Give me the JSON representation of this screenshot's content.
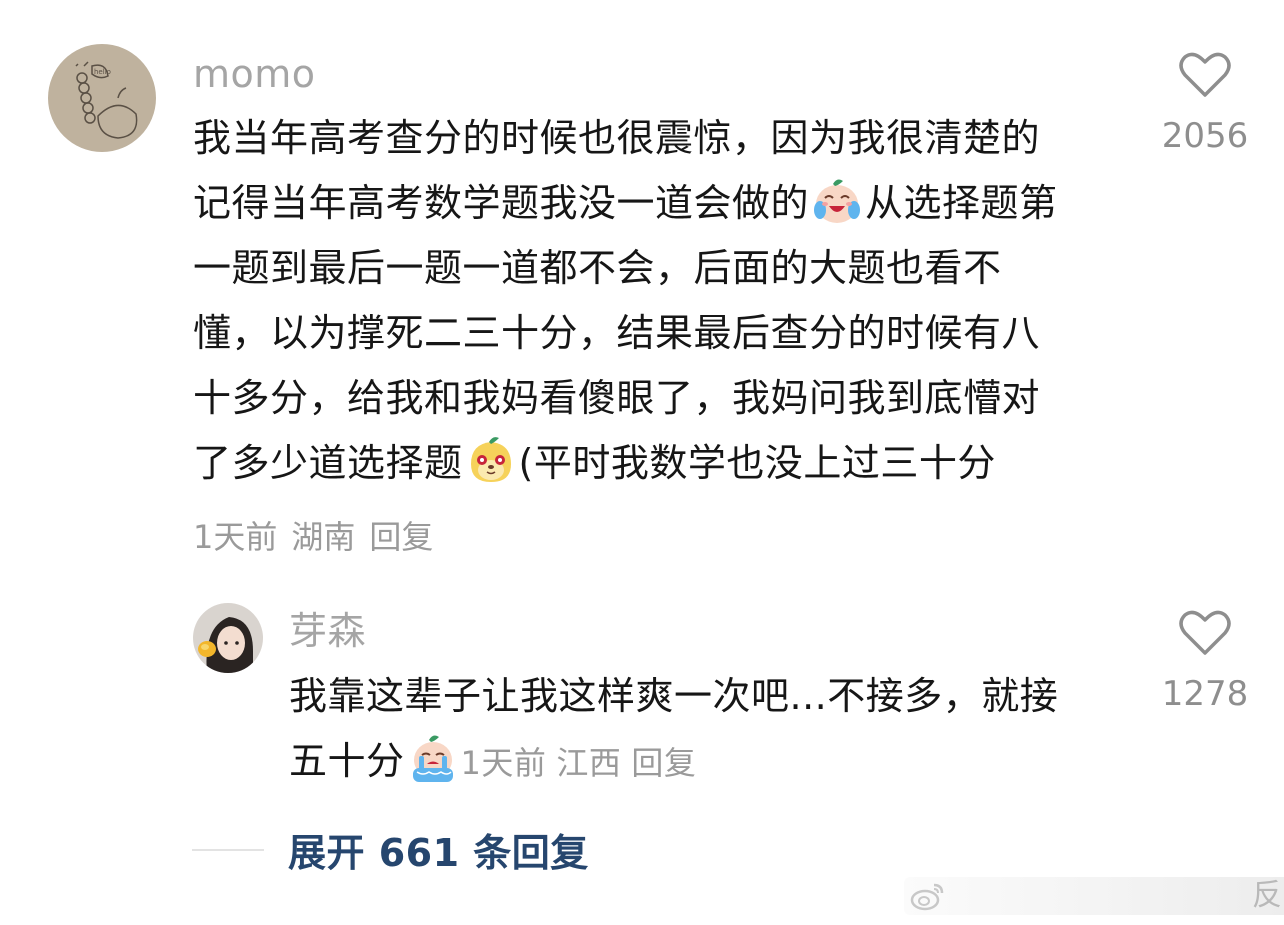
{
  "comments": [
    {
      "username": "momo",
      "avatar_text": "hello",
      "text_lines": [
        "我当年高考查分的时候也很震惊，因为我很清楚的",
        "记得当年高考数学题我没一道会做的",
        "从选择题第",
        "一题到最后一题一道都不会，后面的大题也看不",
        "懂，以为撑死二三十分，结果最后查分的时候有八",
        "十多分，给我和我妈看傻眼了，我妈问我到底懵对",
        "了多少道选择题",
        "(平时我数学也没上过三十分"
      ],
      "emojis": [
        "crying-laugh-emoji",
        "cute-face-emoji"
      ],
      "time": "1天前",
      "location": "湖南",
      "reply_label": "回复",
      "like_count": "2056"
    },
    {
      "username": "芽森",
      "text_lines": [
        "我靠这辈子让我这样爽一次吧...不接多，就接",
        "五十分"
      ],
      "emojis": [
        "crying-emoji"
      ],
      "time": "1天前",
      "location": "江西",
      "reply_label": "回复",
      "like_count": "1278"
    }
  ],
  "expand_replies": "展开 661 条回复",
  "watermark": {
    "text": "反",
    "icon": "weibo-logo-icon"
  },
  "colors": {
    "username": "#a5a5a5",
    "content": "#161616",
    "meta": "#9a9a9a",
    "expand_link": "#26466e"
  }
}
